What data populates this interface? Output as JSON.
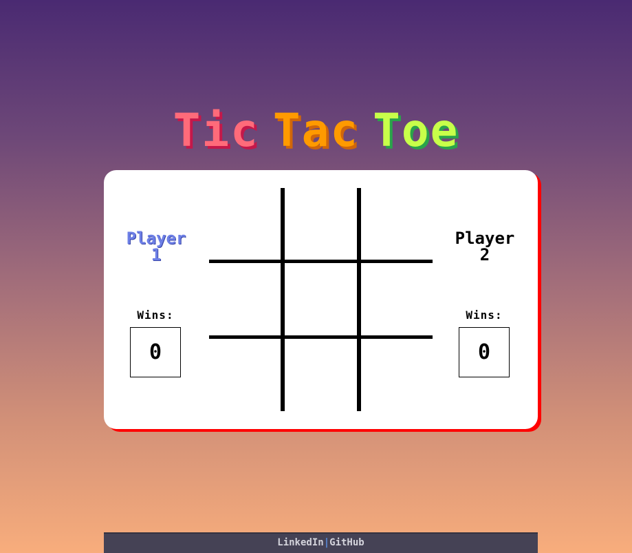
{
  "title": {
    "word1": "Tic",
    "word2": "Tac",
    "word3": "Toe"
  },
  "players": {
    "p1": {
      "line1": "Player",
      "line2": "1",
      "wins_label": "Wins:",
      "wins": "0"
    },
    "p2": {
      "line1": "Player",
      "line2": "2",
      "wins_label": "Wins:",
      "wins": "0"
    }
  },
  "board": {
    "cells": [
      "",
      "",
      "",
      "",
      "",
      "",
      "",
      "",
      ""
    ]
  },
  "footer": {
    "linkedin": "LinkedIn",
    "separator": "|",
    "github": "GitHub"
  },
  "colors": {
    "title_tic": "#ff6b7a",
    "title_tac": "#ff9a00",
    "title_toe": "#c8ff4a",
    "player1": "#6d7fe6",
    "card_shadow": "#ff0000",
    "footer_bg": "#454255"
  }
}
